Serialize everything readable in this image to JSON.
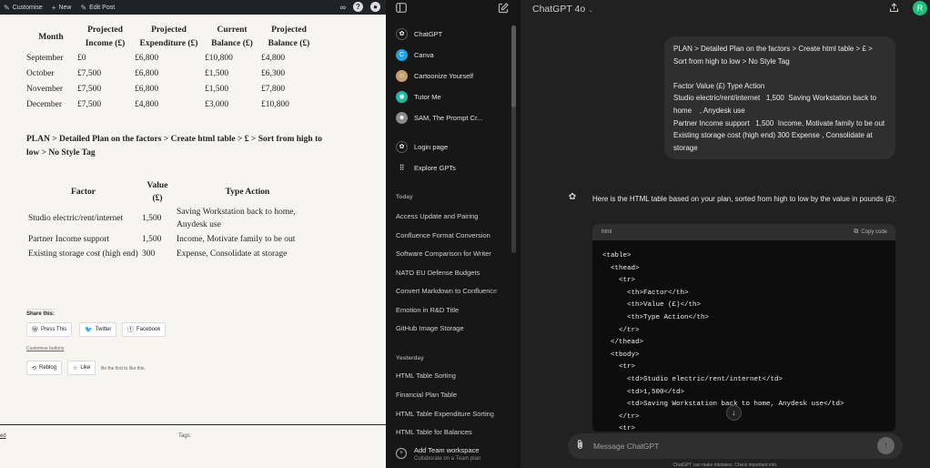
{
  "wp_admin_bar": {
    "items": [
      {
        "icon": "brush-icon",
        "label": "Customise"
      },
      {
        "icon": "plus-icon",
        "label": "New"
      },
      {
        "icon": "pencil-icon",
        "label": "Edit Post"
      }
    ]
  },
  "blog": {
    "finance_table": {
      "headers": [
        [
          "Month",
          ""
        ],
        [
          "Projected",
          "Income (£)"
        ],
        [
          "Projected",
          "Expenditure (£)"
        ],
        [
          "Current",
          "Balance (£)"
        ],
        [
          "Projected",
          "Balance (£)"
        ]
      ],
      "rows": [
        [
          "September",
          "£0",
          "£6,800",
          "£10,800",
          "£4,800"
        ],
        [
          "October",
          "£7,500",
          "£6,800",
          "£1,500",
          "£6,300"
        ],
        [
          "November",
          "£7,500",
          "£6,800",
          "£1,500",
          "£7,800"
        ],
        [
          "December",
          "£7,500",
          "£4,800",
          "£3,000",
          "£10,800"
        ]
      ]
    },
    "plan_heading": "PLAN > Detailed Plan on the factors > Create html table > £ > Sort from high to low > No Style Tag",
    "factor_table": {
      "headers": [
        "Factor",
        "Value (£)",
        "Type Action"
      ],
      "rows": [
        [
          "Studio electric/rent/internet",
          "1,500",
          "Saving Workstation back to home, Anydesk use"
        ],
        [
          "Partner Income support",
          "1,500",
          "Income, Motivate family to be out"
        ],
        [
          "Existing storage cost (high end)",
          "300",
          "Expense, Consolidate at storage"
        ]
      ]
    },
    "share_label": "Share this:",
    "share_buttons": [
      {
        "icon": "wordpress-icon",
        "label": "Press This"
      },
      {
        "icon": "twitter-icon",
        "label": "Twitter"
      },
      {
        "icon": "facebook-icon",
        "label": "Facebook"
      }
    ],
    "customise_buttons": "Customise buttons",
    "reblog": "Reblog",
    "like": "Like",
    "first_to_like": "Be the first to like this.",
    "footer_left": "ed",
    "footer_tags": "Tags:"
  },
  "sidebar": {
    "gpts": [
      {
        "label": "ChatGPT",
        "icon": "openai-icon",
        "color": "#171717"
      },
      {
        "label": "Canva",
        "icon": "canva-icon",
        "color": "#1fa2e0"
      },
      {
        "label": "Cartoonize Yourself",
        "icon": "cartoon-icon",
        "color": "#c8a070"
      },
      {
        "label": "Tutor Me",
        "icon": "tutor-icon",
        "color": "#20b9a6"
      },
      {
        "label": "SAM, The Prompt Cr...",
        "icon": "sam-icon",
        "color": "#8a8a8a"
      }
    ],
    "login_page": "Login page",
    "explore": "Explore GPTs",
    "today_label": "Today",
    "today": [
      "Access Update and Pairing",
      "Confluence Format Conversion",
      "Software Comparison for Writer",
      "NATO EU Defense Budgets",
      "Convert Markdown to Confluence",
      "Emotion in R&D Title",
      "GitHub Image Storage"
    ],
    "yesterday_label": "Yesterday",
    "yesterday": [
      "HTML Table Sorting",
      "Financial Plan Table",
      "HTML Table Expenditure Sorting",
      "HTML Table for Balances"
    ],
    "team_title": "Add Team workspace",
    "team_sub": "Collaborate on a Team plan"
  },
  "chat": {
    "model": "ChatGPT 4o",
    "avatar_initial": "R",
    "user_message": "PLAN > Detailed Plan on the factors > Create html table > £ > Sort from high to low > No Style Tag\n\nFactor Value (£) Type Action\nStudio electric/rent/internet   1,500  Saving Workstation back to home    , Anydesk use\nPartner Income support   1,500  Income, Motivate family to be out\nExisting storage cost (high end) 300 Expense , Consolidate at storage",
    "assistant_text": "Here is the HTML table based on your plan, sorted from high to low by the value in pounds (£):",
    "code_lang": "html",
    "copy_label": "Copy code",
    "code_lines": [
      "<table>",
      "  <thead>",
      "    <tr>",
      "      <th>Factor</th>",
      "      <th>Value (£)</th>",
      "      <th>Type Action</th>",
      "    </tr>",
      "  </thead>",
      "  <tbody>",
      "    <tr>",
      "      <td>Studio electric/rent/internet</td>",
      "      <td>1,500</td>",
      "      <td>Saving Workstation back to home, Anydesk use</td>",
      "    </tr>",
      "    <tr>"
    ],
    "placeholder": "Message ChatGPT",
    "disclaimer": "ChatGPT can make mistakes. Check important info."
  }
}
